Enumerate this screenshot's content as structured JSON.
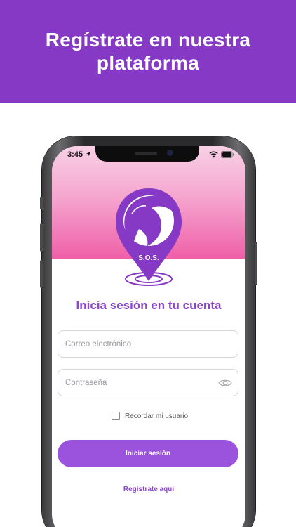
{
  "banner": {
    "title": "Regístrate en nuestra plataforma"
  },
  "status_bar": {
    "time": "3:45"
  },
  "logo": {
    "text": "S.O.S."
  },
  "login": {
    "title": "Inicia sesión en tu cuenta",
    "email_placeholder": "Correo electrónico",
    "password_placeholder": "Contraseña",
    "remember_label": "Recordar mi usuario",
    "submit_label": "Iniciar sesión",
    "register_link": "Registrate aqui"
  },
  "colors": {
    "banner": "#8539c4",
    "accent": "#9b53dd",
    "title": "#8c44d2",
    "header_gradient_top": "#f8d0e6",
    "header_gradient_bottom": "#ef5fa8"
  }
}
